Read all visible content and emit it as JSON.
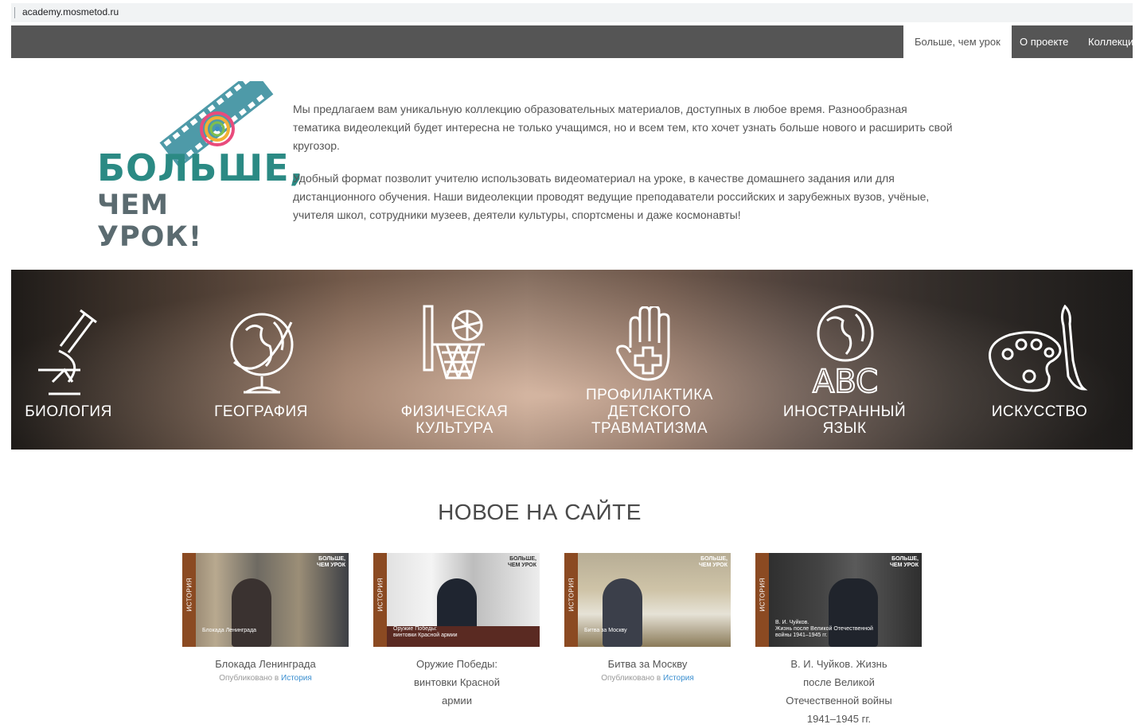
{
  "browser": {
    "url": "academy.mosmetod.ru"
  },
  "nav": {
    "items": [
      "Больше, чем урок",
      "О проекте",
      "Коллекции"
    ]
  },
  "logo": {
    "line1": "БОЛЬШЕ,",
    "line2": "ЧЕМ УРОК!"
  },
  "intro": {
    "p1": "Мы предлагаем вам уникальную коллекцию образовательных материалов, доступных в любое время. Разнообразная тематика видеолекций будет интересна не только учащимся, но и всем тем, кто хочет узнать больше нового и расширить свой кругозор.",
    "p2": "Удобный формат позволит учителю использовать видеоматериал на уроке, в качестве домашнего задания или для дистанционного обучения. Наши видеолекции проводят ведущие преподаватели российских и зарубежных вузов, учёные, учителя школ, сотрудники музеев, деятели культуры, спортсмены и даже космонавты!"
  },
  "subjects": [
    {
      "label": "БИОЛОГИЯ",
      "icon": "microscope-icon"
    },
    {
      "label": "ГЕОГРАФИЯ",
      "icon": "globe-icon"
    },
    {
      "label": "ФИЗИЧЕСКАЯ\nКУЛЬТУРА",
      "icon": "basketball-hoop-icon"
    },
    {
      "label": "ПРОФИЛАКТИКА\nДЕТСКОГО\nТРАВМАТИЗМА",
      "icon": "hand-cross-icon"
    },
    {
      "label": "ИНОСТРАННЫЙ\nЯЗЫК",
      "icon": "globe-abc-icon"
    },
    {
      "label": "ИСКУССТВО",
      "icon": "palette-icon"
    }
  ],
  "news": {
    "title": "НОВОЕ НА САЙТЕ",
    "published_prefix": "Опубликовано в",
    "cards": [
      {
        "title": "Блокада Ленинграда",
        "category": "История",
        "thumb_side": "ИСТОРИЯ",
        "thumb_caption": "Блокада Ленинграда",
        "brand": "БОЛЬШЕ,\nЧЕМ УРОК",
        "meta": true
      },
      {
        "title": "Оружие Победы: винтовки Красной армии",
        "category": "История",
        "thumb_side": "ИСТОРИЯ",
        "thumb_caption": "Оружие Победы:\nвинтовки Красной армии",
        "brand": "БОЛЬШЕ,\nЧЕМ УРОК",
        "meta": false
      },
      {
        "title": "Битва за Москву",
        "category": "История",
        "thumb_side": "ИСТОРИЯ",
        "thumb_caption": "Битва за Москву",
        "brand": "БОЛЬШЕ,\nЧЕМ УРОК",
        "meta": true
      },
      {
        "title": "В. И. Чуйков. Жизнь после Великой Отечественной войны 1941–1945 гг.",
        "category": "История",
        "thumb_side": "ИСТОРИЯ",
        "thumb_caption": "В. И. Чуйков.\nЖизнь после Великой Отечественной\nвойны 1941–1945 гг.",
        "brand": "БОЛЬШЕ,\nЧЕМ УРОК",
        "meta": false
      }
    ]
  },
  "colors": {
    "nav_bg": "#555555",
    "logo_teal": "#2b8a84",
    "logo_gray": "#5b6b70",
    "thumb_side": "#8b4a22",
    "link": "#3b8fd0"
  }
}
